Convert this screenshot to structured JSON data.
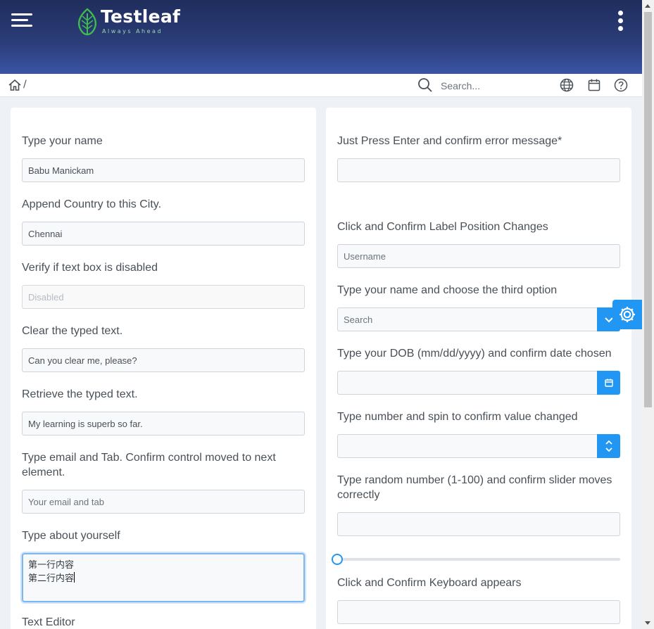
{
  "header": {
    "brand_name": "Testleaf",
    "brand_tagline": "Always Ahead",
    "colors": {
      "primary": "#2196f3",
      "header_dark": "#1f2d5c",
      "header_light": "#3b54a4",
      "leaf_green": "#3fb950"
    }
  },
  "toolbar": {
    "breadcrumb_sep": "/",
    "search_placeholder": "Search...",
    "icons": [
      "home-icon",
      "search-icon",
      "globe-icon",
      "calendar-icon",
      "help-icon"
    ]
  },
  "left_form": [
    {
      "label": "Type your name",
      "value": "Babu Manickam"
    },
    {
      "label": "Append Country to this City.",
      "value": "Chennai"
    },
    {
      "label": "Verify if text box is disabled",
      "placeholder": "Disabled"
    },
    {
      "label": "Clear the typed text.",
      "value": "Can you clear me, please?"
    },
    {
      "label": "Retrieve the typed text.",
      "value": "My learning is superb so far."
    },
    {
      "label": "Type email and Tab. Confirm control moved to next element.",
      "placeholder": "Your email and tab"
    },
    {
      "label": "Type about yourself",
      "line1": "第一行内容",
      "line2": "第二行内容"
    },
    {
      "label": "Text Editor"
    }
  ],
  "right_form": [
    {
      "label": "Just Press Enter and confirm error message*",
      "value": ""
    },
    {
      "label": "Click and Confirm Label Position Changes",
      "placeholder": "Username"
    },
    {
      "label": "Type your name and choose the third option",
      "placeholder": "Search"
    },
    {
      "label": "Type your DOB (mm/dd/yyyy) and confirm date chosen",
      "value": ""
    },
    {
      "label": "Type number and spin to confirm value changed",
      "value": ""
    },
    {
      "label": "Type random number (1-100) and confirm slider moves correctly",
      "value": "",
      "slider_value_fraction": 0.0
    },
    {
      "label": "Click and Confirm Keyboard appears",
      "value": ""
    }
  ]
}
